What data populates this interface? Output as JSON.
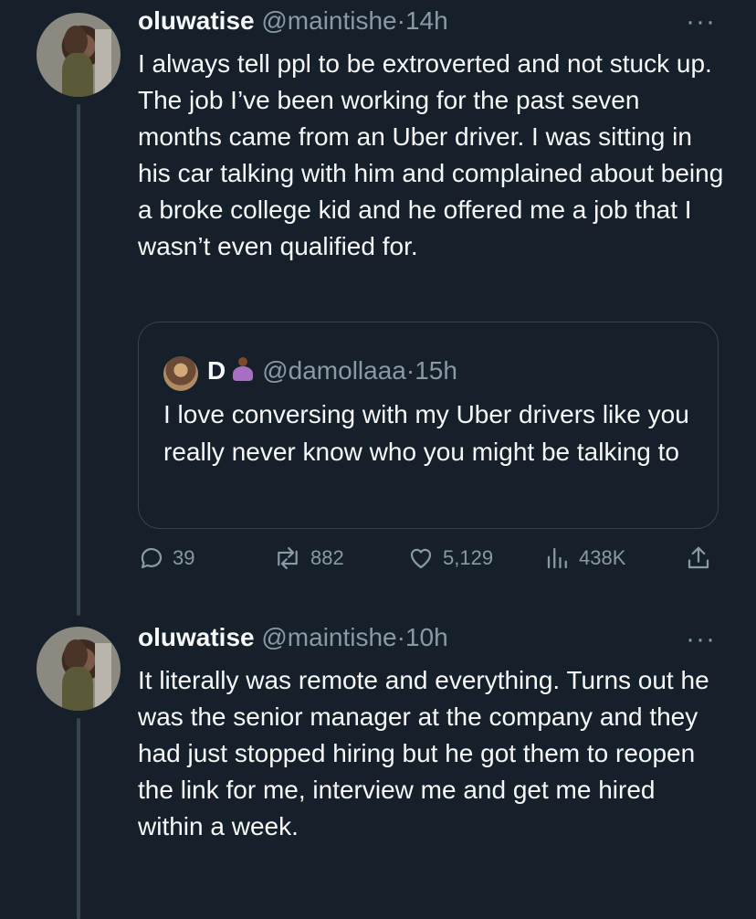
{
  "tweets": [
    {
      "name": "oluwatise",
      "handle": "@maintishe",
      "dot": "·",
      "time": "14h",
      "more": "···",
      "text": "I always tell ppl to be extroverted and not stuck up. The job I’ve been working for the past seven months came from an Uber driver. I was sitting in his car talking with him and complained about being a broke college kid and he offered me a job that I wasn’t even qualified for.",
      "quote": {
        "name": "D",
        "emoji_icon": "person-in-lotus-position-emoji",
        "handle": "@damollaaa",
        "dot": "·",
        "time": "15h",
        "text": "I love conversing with my Uber drivers like you really never know who you might be talking to"
      },
      "actions": {
        "replies": "39",
        "retweets": "882",
        "likes": "5,129",
        "views": "438K"
      }
    },
    {
      "name": "oluwatise",
      "handle": "@maintishe",
      "dot": "·",
      "time": "10h",
      "more": "···",
      "text": "It literally was remote and everything. Turns out he was the senior manager at the company and they had just stopped hiring but he got them to reopen the link for me, interview me and get me hired within a week."
    }
  ],
  "icons": {
    "reply": "reply-icon",
    "retweet": "retweet-icon",
    "like": "heart-icon",
    "views": "views-icon",
    "share": "share-icon"
  },
  "colors": {
    "background": "#15202b",
    "text": "#f7f9f9",
    "muted": "#8b98a5",
    "border": "#38444d"
  }
}
